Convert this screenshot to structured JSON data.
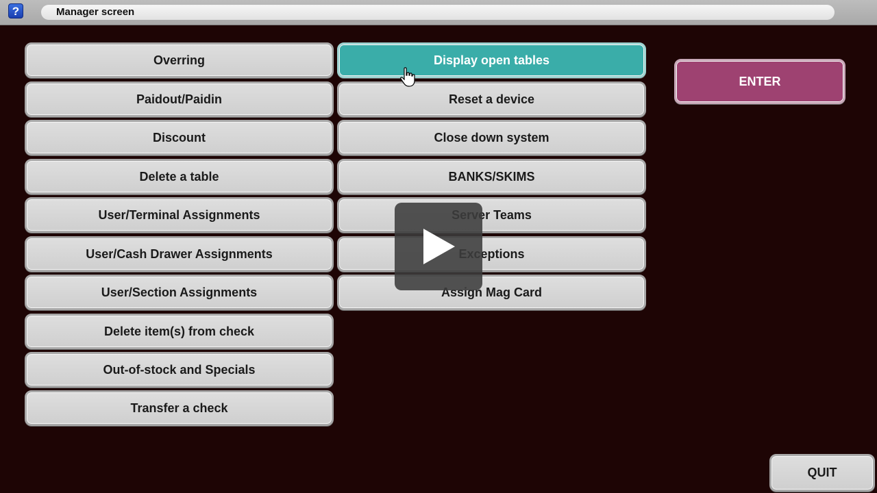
{
  "title_bar": {
    "help_icon_label": "?",
    "title": "Manager screen"
  },
  "left_column": [
    {
      "label": "Overring"
    },
    {
      "label": "Paidout/Paidin"
    },
    {
      "label": "Discount"
    },
    {
      "label": "Delete a table"
    },
    {
      "label": "User/Terminal Assignments"
    },
    {
      "label": "User/Cash Drawer Assignments"
    },
    {
      "label": "User/Section Assignments"
    },
    {
      "label": "Delete item(s) from check"
    },
    {
      "label": "Out-of-stock and Specials"
    },
    {
      "label": "Transfer a check"
    }
  ],
  "right_column": [
    {
      "label": "Display open tables",
      "selected": true
    },
    {
      "label": "Reset a device"
    },
    {
      "label": "Close down system"
    },
    {
      "label": "BANKS/SKIMS"
    },
    {
      "label": "Server Teams"
    },
    {
      "label": "Exceptions"
    },
    {
      "label": "Assign Mag Card"
    }
  ],
  "actions": {
    "enter_label": "ENTER",
    "quit_label": "QUIT"
  },
  "colors": {
    "background": "#1e0505",
    "selected": "#3aada9",
    "enter": "#9e4271",
    "button": "#d6d6d6"
  },
  "icons": {
    "help": "question-mark-icon",
    "cursor": "hand-pointer-icon",
    "video_overlay": "play-icon"
  }
}
